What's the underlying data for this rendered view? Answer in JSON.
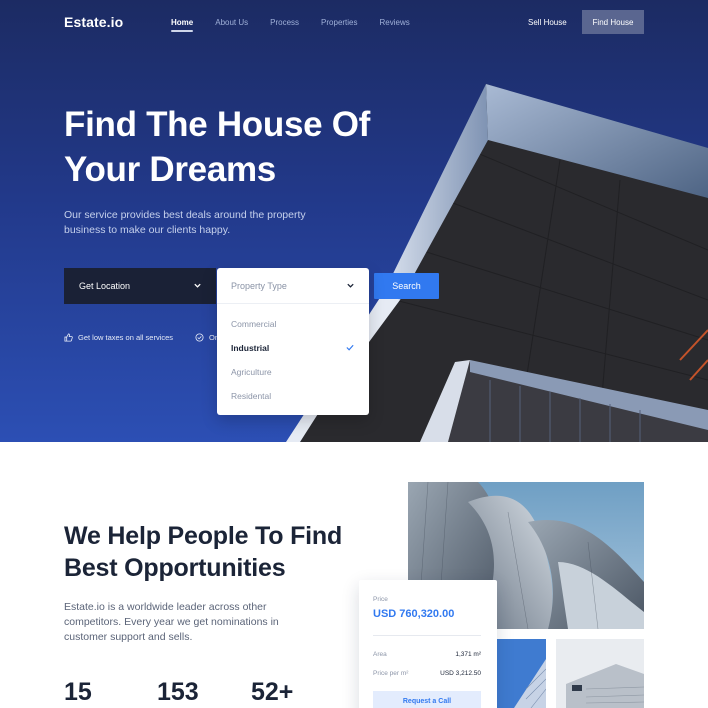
{
  "brand": {
    "name": "Estate.io"
  },
  "nav": {
    "links": [
      {
        "label": "Home",
        "active": true
      },
      {
        "label": "About Us",
        "active": false
      },
      {
        "label": "Process",
        "active": false
      },
      {
        "label": "Properties",
        "active": false
      },
      {
        "label": "Reviews",
        "active": false
      }
    ],
    "sell_label": "Sell House",
    "find_label": "Find House"
  },
  "hero": {
    "headline_line1": "Find The House Of",
    "headline_line2": "Your Dreams",
    "subtext": "Our service provides best deals around the property business to make our clients happy.",
    "location_select": "Get Location",
    "type_select": {
      "placeholder": "Property Type",
      "options": [
        {
          "label": "Commercial",
          "selected": false
        },
        {
          "label": "Industrial",
          "selected": true
        },
        {
          "label": "Agriculture",
          "selected": false
        },
        {
          "label": "Residental",
          "selected": false
        }
      ]
    },
    "search_label": "Search",
    "perks": [
      {
        "icon": "thumbs-up-icon",
        "label": "Get low taxes on all services"
      },
      {
        "icon": "check-circle-icon",
        "label": "On"
      }
    ]
  },
  "section": {
    "title_line1": "We Help People To Find",
    "title_line2": "Best Opportunities",
    "paragraph": "Estate.io is a worldwide leader across other competitors. Every year we get nominations in customer support and sells.",
    "stats": [
      "15",
      "153",
      "52+"
    ]
  },
  "price_card": {
    "price_label": "Price",
    "price_value": "USD 760,320.00",
    "rows": [
      {
        "key": "Area",
        "value": "1,371 m²"
      },
      {
        "key": "Price per m²",
        "value": "USD 3,212.50"
      }
    ],
    "button_label": "Request a Call"
  },
  "colors": {
    "accent": "#3179f0",
    "hero_dark": "#1c2b63",
    "hero_light": "#2c4fb4",
    "text_dark": "#1b2437"
  }
}
